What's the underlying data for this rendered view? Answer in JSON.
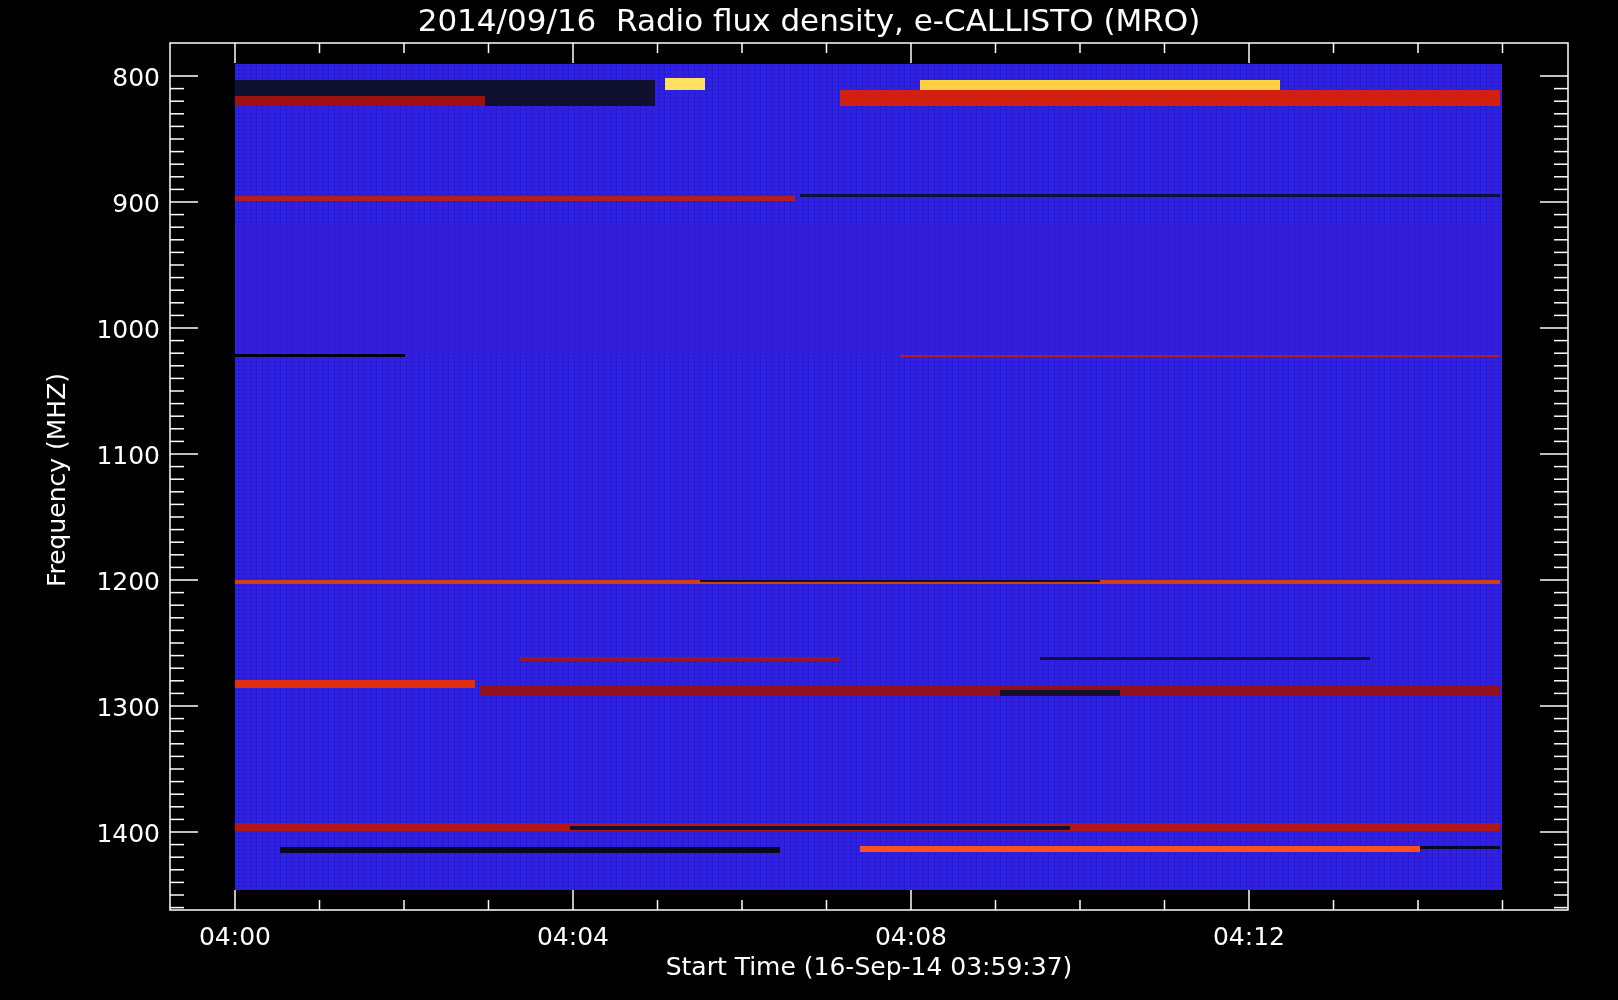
{
  "plot": {
    "title": "2014/09/16  Radio flux density, e-CALLISTO (MRO)",
    "xaxis": {
      "label": "Start Time (16-Sep-14 03:59:37)",
      "ticks": [
        "04:00",
        "04:04",
        "04:08",
        "04:12"
      ]
    },
    "yaxis": {
      "label": "Frequency (MHZ)",
      "ticks": [
        "800",
        "900",
        "1000",
        "1100",
        "1200",
        "1300",
        "1400"
      ]
    }
  }
}
